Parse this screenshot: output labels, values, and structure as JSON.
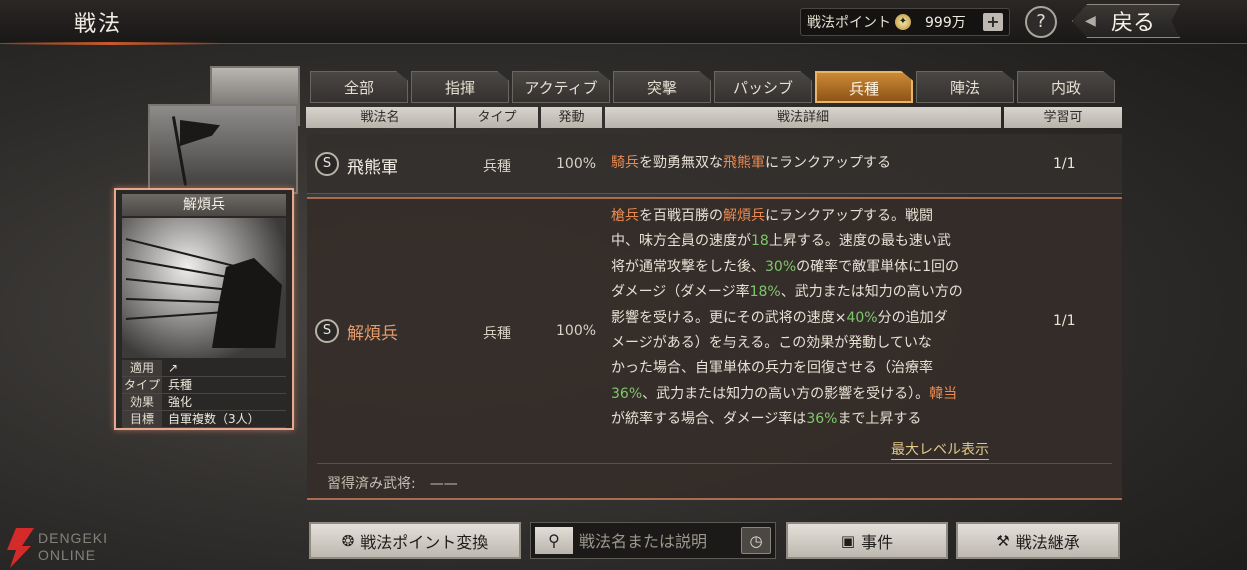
{
  "header": {
    "title": "戦法",
    "points_label": "戦法ポイント",
    "points_value": "999万",
    "plus_label": "+",
    "help_label": "?",
    "back_label": "戻る"
  },
  "card": {
    "name": "解煩兵",
    "info": [
      {
        "key": "適用",
        "value": "↗"
      },
      {
        "key": "タイプ",
        "value": "兵種"
      },
      {
        "key": "効果",
        "value": "強化"
      },
      {
        "key": "目標",
        "value": "自軍複数（3人）"
      }
    ]
  },
  "tabs": [
    {
      "label": "全部"
    },
    {
      "label": "指揮"
    },
    {
      "label": "アクティブ"
    },
    {
      "label": "突撃"
    },
    {
      "label": "パッシブ"
    },
    {
      "label": "兵種",
      "active": true
    },
    {
      "label": "陣法"
    },
    {
      "label": "内政"
    }
  ],
  "columns": [
    "戦法名",
    "タイプ",
    "発動",
    "戦法詳細",
    "学習可"
  ],
  "rows": [
    {
      "rank": "S",
      "name": "飛熊軍",
      "type": "兵種",
      "rate": "100%",
      "detail": "騎兵を勁勇無双な飛熊軍にランクアップする",
      "learn": "1/1"
    },
    {
      "rank": "S",
      "name": "解煩兵",
      "type": "兵種",
      "rate": "100%",
      "detail_lines": [
        "槍兵を百戦百勝の解煩兵にランクアップする。戦闘",
        "中、味方全員の速度が18上昇する。速度の最も速い武",
        "将が通常攻撃をした後、30%の確率で敵軍単体に1回の",
        "ダメージ（ダメージ率18%、武力または知力の高い方の",
        "影響を受ける。更にその武将の速度×40%分の追加ダ",
        "メージがある）を与える。この効果が発動していな",
        "かった場合、自軍単体の兵力を回復させる（治療率",
        "36%、武力または知力の高い方の影響を受ける）。韓当",
        "が統率する場合、ダメージ率は36%まで上昇する"
      ],
      "max_level_label": "最大レベル表示",
      "learned_label": "習得済み武将:　——",
      "learn": "1/1"
    }
  ],
  "bottom": {
    "convert_label": "戦法ポイント変換",
    "search_placeholder": "戦法名または説明",
    "event_label": "事件",
    "inherit_label": "戦法継承"
  },
  "watermark": {
    "line1": "DENGEKI",
    "line2": "ONLINE"
  },
  "colors": {
    "accent_orange": "#cc8a35",
    "highlight_orange": "#e98a52",
    "highlight_green": "#7fc76c"
  }
}
